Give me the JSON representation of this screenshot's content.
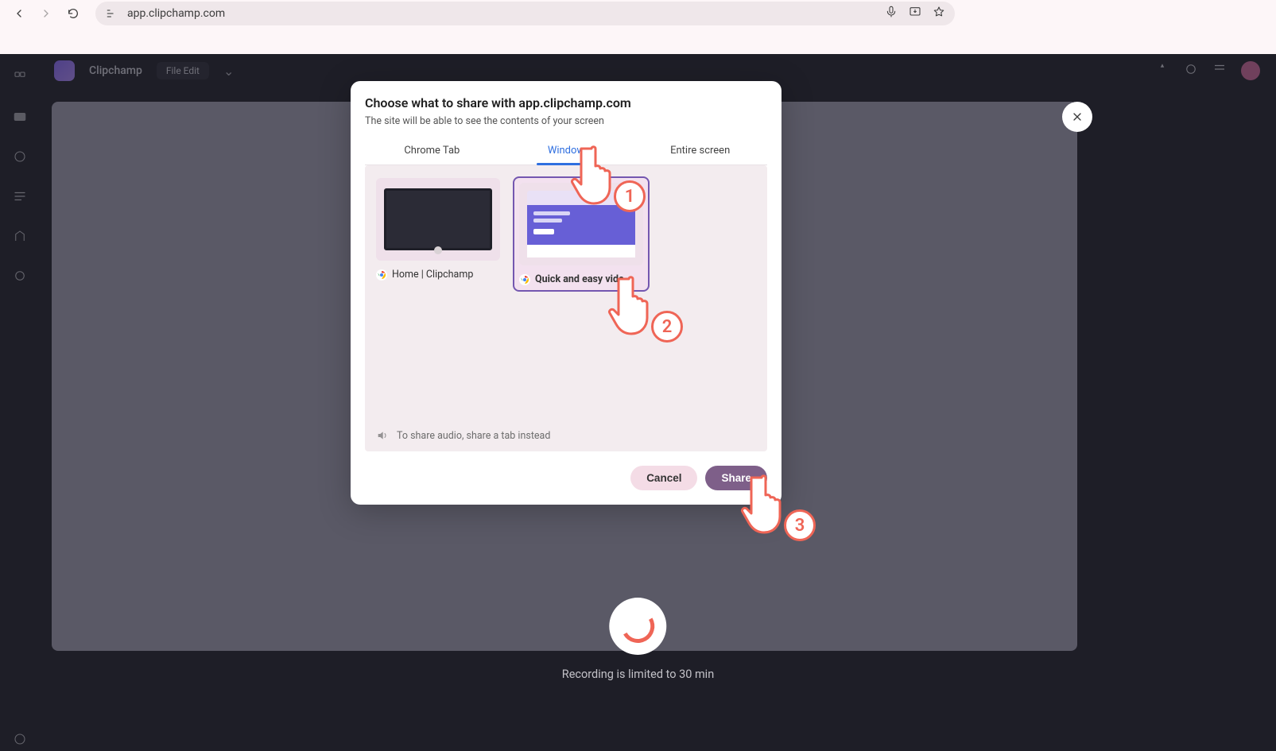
{
  "browser": {
    "url": "app.clipchamp.com"
  },
  "app": {
    "brand": "Clipchamp",
    "top_tab": "File Edit",
    "recording_limit": "Recording is limited to 30 min"
  },
  "dialog": {
    "title": "Choose what to share with app.clipchamp.com",
    "subtitle": "The site will be able to see the contents of your screen",
    "tabs": {
      "chrome": "Chrome Tab",
      "window": "Window",
      "screen": "Entire screen"
    },
    "windows": [
      {
        "label": "Home | Clipchamp"
      },
      {
        "label": "Quick and easy vide..",
        "selected": true
      }
    ],
    "audio_hint": "To share audio, share a tab instead",
    "cancel": "Cancel",
    "share": "Share"
  },
  "callouts": {
    "one": "1",
    "two": "2",
    "three": "3"
  }
}
